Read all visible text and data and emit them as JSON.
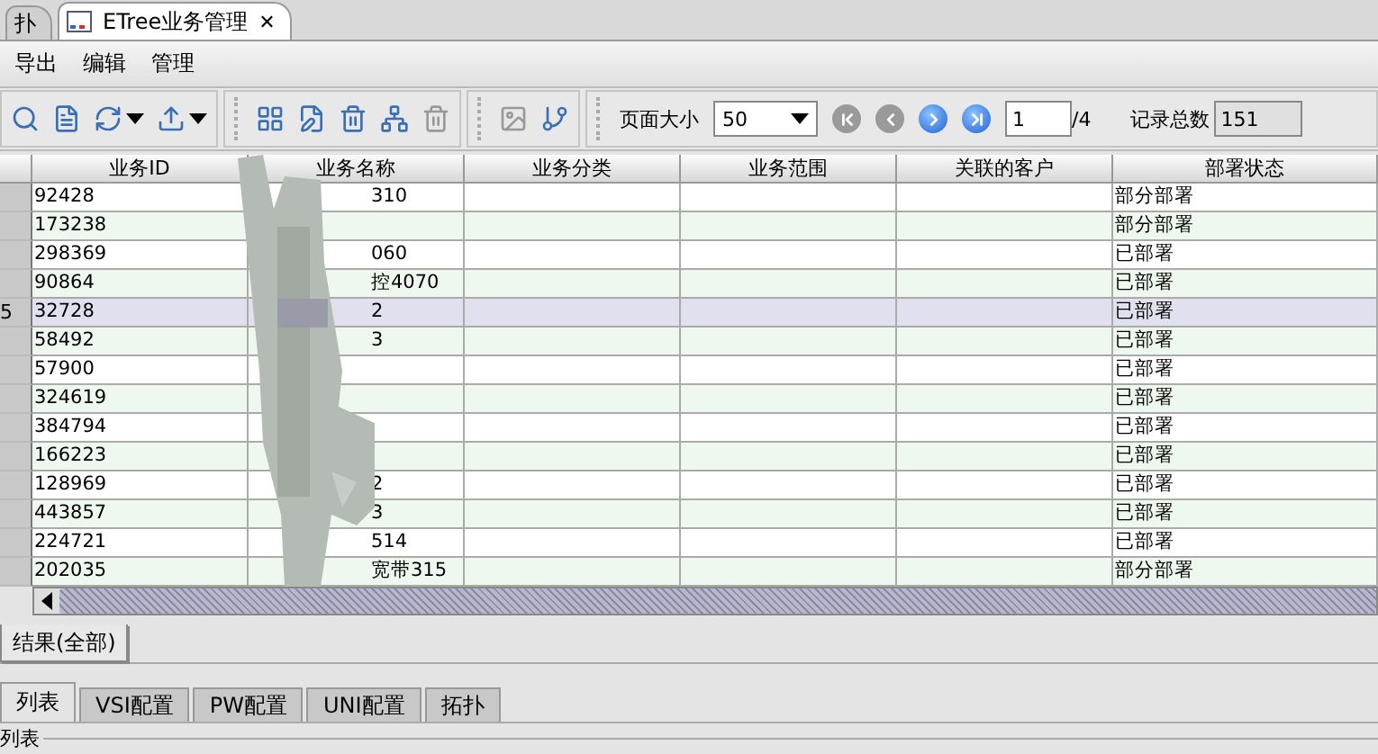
{
  "editor_tabs": [
    {
      "label": "扑",
      "selected": false
    },
    {
      "label": "ETree业务管理",
      "selected": true,
      "close": "✕"
    }
  ],
  "menu": [
    "导出",
    "编辑",
    "管理"
  ],
  "toolbar": {
    "groups": [
      [
        {
          "kind": "search",
          "disabled": false
        },
        {
          "kind": "document",
          "disabled": false
        },
        {
          "kind": "refresh",
          "disabled": false,
          "dropdown": true
        },
        {
          "kind": "export",
          "disabled": false,
          "dropdown": true
        }
      ],
      [
        {
          "kind": "chart",
          "disabled": false
        },
        {
          "kind": "edit",
          "disabled": false
        },
        {
          "kind": "trash",
          "disabled": false
        },
        {
          "kind": "network",
          "disabled": false
        },
        {
          "kind": "trash",
          "disabled": true
        }
      ],
      [
        {
          "kind": "image",
          "disabled": true
        },
        {
          "kind": "tree",
          "disabled": false
        }
      ]
    ],
    "page_size_label": "页面大小",
    "page_size": "50",
    "nav": [
      {
        "kind": "first",
        "disabled": true
      },
      {
        "kind": "prev",
        "disabled": true
      },
      {
        "kind": "next",
        "disabled": false
      },
      {
        "kind": "last",
        "disabled": false
      }
    ],
    "page": "1",
    "page_total": "/4",
    "total_label": "记录总数",
    "total": "151"
  },
  "table": {
    "columns": [
      "业务ID",
      "业务名称",
      "业务分类",
      "业务范围",
      "关联的客户",
      "部署状态"
    ],
    "rows": [
      {
        "id": "92428",
        "name": "310",
        "status": "部分部署",
        "selected": false
      },
      {
        "id": "173238",
        "status": "部分部署",
        "selected": false
      },
      {
        "id": "298369",
        "name": "060",
        "status": "已部署",
        "selected": false
      },
      {
        "id": "90864",
        "name": "控4070",
        "status": "已部署",
        "selected": false
      },
      {
        "row_number": "5",
        "id": "32728",
        "name": "2",
        "status": "已部署",
        "selected": true
      },
      {
        "id": "58492",
        "name": "3",
        "status": "已部署",
        "selected": false
      },
      {
        "id": "57900",
        "status": "已部署",
        "selected": false
      },
      {
        "id": "324619",
        "status": "已部署",
        "selected": false
      },
      {
        "id": "384794",
        "status": "已部署",
        "selected": false
      },
      {
        "id": "166223",
        "status": "已部署",
        "selected": false
      },
      {
        "id": "128969",
        "name": "2",
        "status": "已部署",
        "selected": false
      },
      {
        "id": "443857",
        "name": "3",
        "status": "已部署",
        "selected": false
      },
      {
        "id": "224721",
        "name": "514",
        "status": "已部署",
        "selected": false
      },
      {
        "id": "202035",
        "name": "宽带315",
        "status": "部分部署",
        "selected": false
      }
    ]
  },
  "result_tab": "结果(全部)",
  "bottom_tabs": [
    {
      "label": "列表",
      "selected": true
    },
    {
      "label": "VSI配置",
      "selected": false
    },
    {
      "label": "PW配置",
      "selected": false
    },
    {
      "label": "UNI配置",
      "selected": false
    },
    {
      "label": "拓扑",
      "selected": false
    }
  ],
  "section_label": "列表"
}
